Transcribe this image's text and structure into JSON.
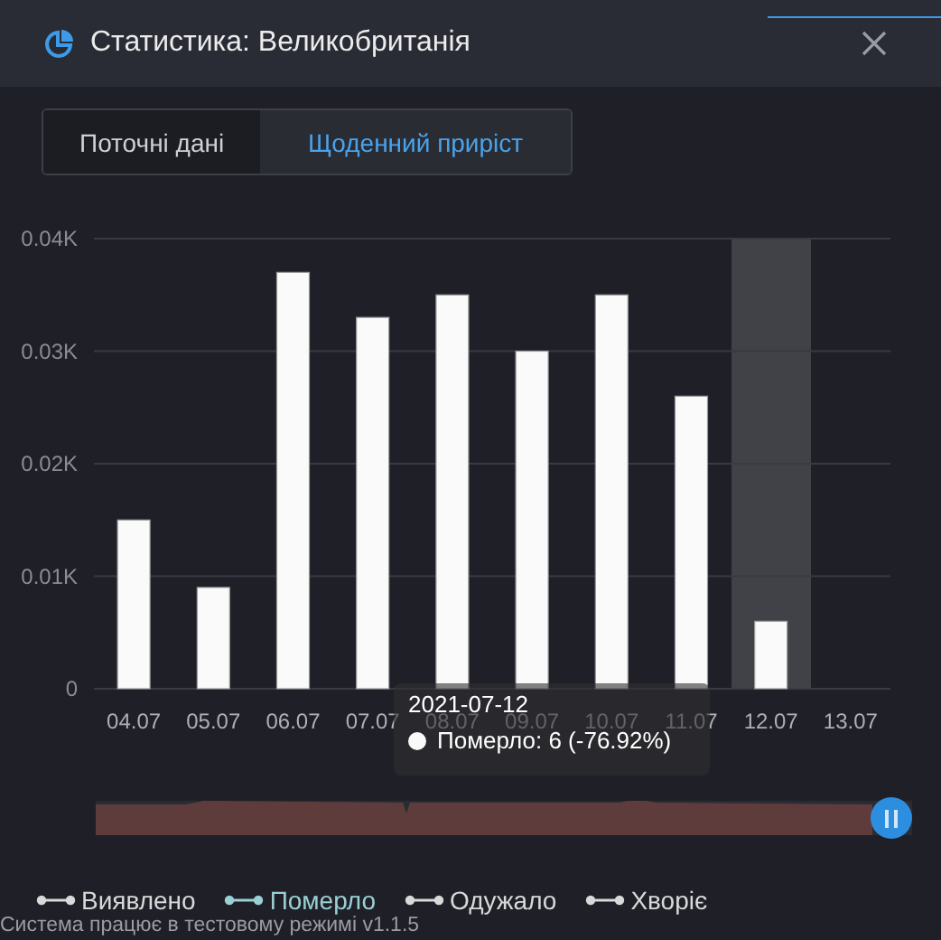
{
  "window": {
    "title": "Статистика: Великобританія"
  },
  "tabs": [
    {
      "label": "Поточні дані",
      "selected": false
    },
    {
      "label": "Щоденний приріст",
      "selected": true
    }
  ],
  "chart": {
    "chart_data": {
      "type": "bar",
      "categories": [
        "04.07",
        "05.07",
        "06.07",
        "07.07",
        "08.07",
        "09.07",
        "10.07",
        "11.07",
        "12.07",
        "13.07"
      ],
      "series": [
        {
          "color": "#fafafa",
          "values": [
            15,
            9,
            37,
            33,
            35,
            30,
            35,
            26,
            6,
            null
          ]
        }
      ],
      "ylim": [
        0,
        40
      ],
      "grid": true,
      "yticks": [
        {
          "value": 0,
          "label": "0"
        },
        {
          "value": 10,
          "label": "0.01K"
        },
        {
          "value": 20,
          "label": "0.02K"
        },
        {
          "value": 30,
          "label": "0.03K"
        },
        {
          "value": 40,
          "label": "0.04K"
        }
      ]
    },
    "columns": [
      {
        "selected": false
      },
      {
        "selected": false
      },
      {
        "selected": false
      },
      {
        "selected": false
      },
      {
        "selected": false
      },
      {
        "selected": false
      },
      {
        "selected": false
      },
      {
        "selected": false
      },
      {
        "selected": true
      },
      {
        "selected": false
      }
    ],
    "tooltip": {
      "date": "2021-07-12",
      "text": "Померло: 6 (-76.92%)"
    }
  },
  "zoom_slider": {
    "level": 1
  },
  "legend": [
    {
      "label": "Виявлено",
      "selected": false
    },
    {
      "label": "Померло",
      "selected": true
    },
    {
      "label": "Одужало",
      "selected": false
    },
    {
      "label": "Хворіє",
      "selected": false
    }
  ],
  "footer": "Система працює в тестовому режимі v1.1.5"
}
